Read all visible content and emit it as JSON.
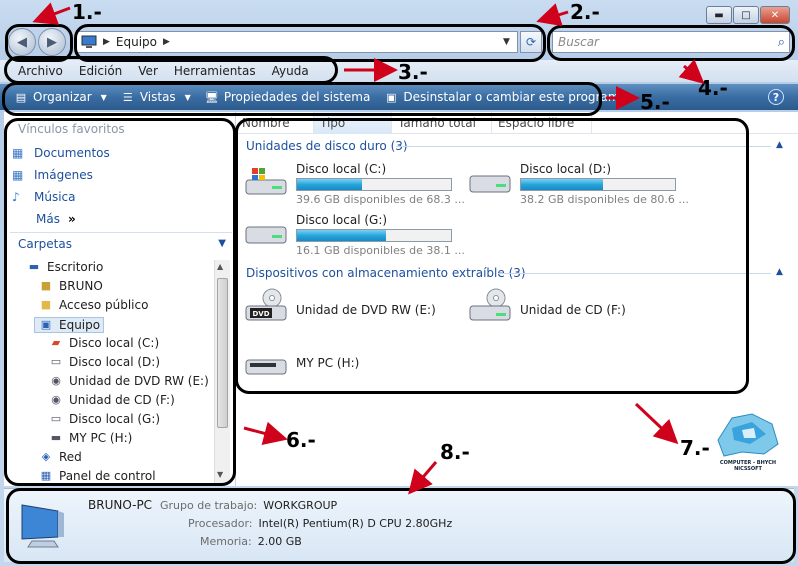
{
  "window": {
    "caption_min": "▬",
    "caption_max": "□",
    "caption_close": "✕"
  },
  "address": {
    "location": "Equipo"
  },
  "search": {
    "placeholder": "Buscar"
  },
  "menu": [
    "Archivo",
    "Edición",
    "Ver",
    "Herramientas",
    "Ayuda"
  ],
  "commands": {
    "organize": "Organizar",
    "views": "Vistas",
    "system_properties": "Propiedades del sistema",
    "uninstall": "Desinstalar o cambiar este programa"
  },
  "favorites": {
    "title": "Vínculos favoritos",
    "items": [
      "Documentos",
      "Imágenes",
      "Música"
    ],
    "more": "Más",
    "more_chev": "»"
  },
  "folders": {
    "title": "Carpetas",
    "items": [
      {
        "label": "Escritorio",
        "icon": "desktop-icon"
      },
      {
        "label": "BRUNO",
        "icon": "user-folder-icon"
      },
      {
        "label": "Acceso público",
        "icon": "folder-icon"
      },
      {
        "label": "Equipo",
        "icon": "computer-icon"
      },
      {
        "label": "Disco local (C:)",
        "icon": "windows-drive-icon"
      },
      {
        "label": "Disco local (D:)",
        "icon": "hard-drive-icon"
      },
      {
        "label": "Unidad de DVD RW (E:)",
        "icon": "dvd-drive-icon"
      },
      {
        "label": "Unidad de CD (F:)",
        "icon": "cd-drive-icon"
      },
      {
        "label": "Disco local (G:)",
        "icon": "hard-drive-icon"
      },
      {
        "label": "MY PC (H:)",
        "icon": "removable-drive-icon"
      },
      {
        "label": "Red",
        "icon": "network-icon"
      },
      {
        "label": "Panel de control",
        "icon": "control-panel-icon"
      }
    ]
  },
  "columns": [
    "Nombre",
    "Tipo",
    "Tamaño total",
    "Espacio libre"
  ],
  "groups": {
    "hard_drives": "Unidades de disco duro (3)",
    "removable": "Dispositivos con almacenamiento extraíble (3)"
  },
  "drives": [
    {
      "name": "Disco local (C:)",
      "free": "39.6 GB disponibles de 68.3 ...",
      "used_fraction": 0.42,
      "icon": "windows-drive-icon"
    },
    {
      "name": "Disco local (D:)",
      "free": "38.2 GB disponibles de 80.6 ...",
      "used_fraction": 0.53,
      "icon": "hard-drive-icon"
    },
    {
      "name": "Disco local (G:)",
      "free": "16.1 GB disponibles de 38.1 ...",
      "used_fraction": 0.58,
      "icon": "hard-drive-icon"
    }
  ],
  "removables": [
    {
      "name": "Unidad de DVD RW (E:)",
      "icon": "dvd-drive-icon",
      "badge": "DVD"
    },
    {
      "name": "Unidad de CD (F:)",
      "icon": "cd-drive-icon"
    },
    {
      "name": "MY PC (H:)",
      "icon": "removable-drive-icon"
    }
  ],
  "details": {
    "pc_name": "BRUNO-PC",
    "workgroup_label": "Grupo de trabajo:",
    "workgroup": "WORKGROUP",
    "processor_label": "Procesador:",
    "processor": "Intel(R) Pentium(R) D CPU 2.80GHz",
    "memory_label": "Memoria:",
    "memory": "2.00 GB"
  },
  "annotations": [
    "1.-",
    "2.-",
    "3.-",
    "4.-",
    "5.-",
    "6.-",
    "7.-",
    "8.-"
  ],
  "logo": {
    "text": "COMPUTER - BHYCH NICSSOFT"
  },
  "colors": {
    "accent": "#1c4f9c",
    "command_bar": "#3a6da3",
    "progress": "#27a6dc",
    "annotation_arrow": "#d0021b"
  }
}
